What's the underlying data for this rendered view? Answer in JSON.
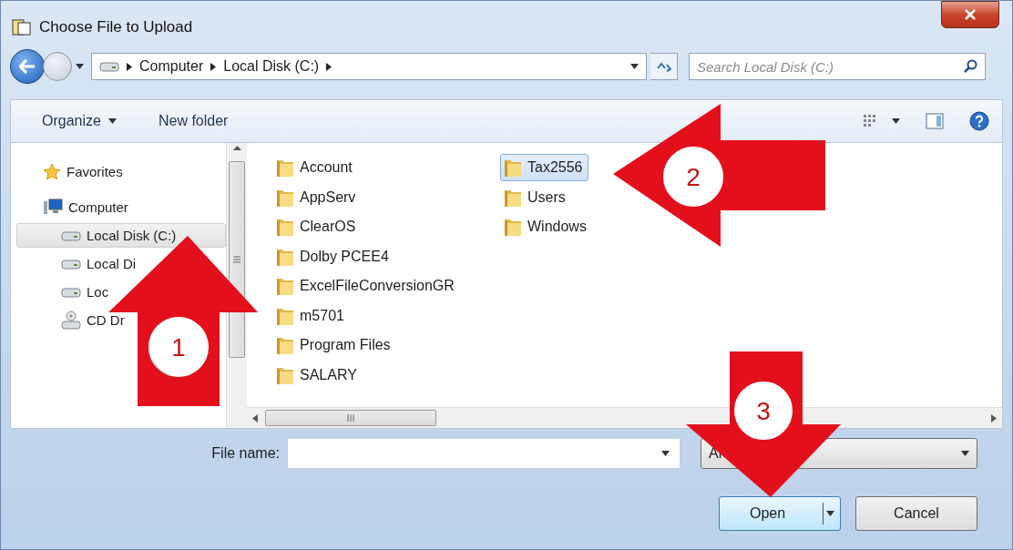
{
  "window": {
    "title": "Choose File to Upload"
  },
  "address_bar": {
    "breadcrumbs": [
      "Computer",
      "Local Disk (C:)"
    ]
  },
  "search": {
    "placeholder": "Search Local Disk (C:)"
  },
  "toolbar": {
    "organize": "Organize",
    "new_folder": "New folder"
  },
  "sidebar": {
    "items": [
      {
        "label": "Favorites",
        "kind": "favorites",
        "selected": false
      },
      {
        "label": "Computer",
        "kind": "computer",
        "selected": false,
        "children": [
          {
            "label": "Local Disk (C:)",
            "kind": "drive",
            "selected": true
          },
          {
            "label": "Local Di",
            "kind": "drive",
            "selected": false
          },
          {
            "label": "Loc",
            "kind": "drive",
            "selected": false
          },
          {
            "label": "CD Dr",
            "kind": "cd",
            "selected": false
          }
        ]
      }
    ]
  },
  "folders": [
    {
      "name": "Account",
      "selected": false
    },
    {
      "name": "AppServ",
      "selected": false
    },
    {
      "name": "ClearOS",
      "selected": false
    },
    {
      "name": "Dolby PCEE4",
      "selected": false
    },
    {
      "name": "ExcelFileConversionGR",
      "selected": false
    },
    {
      "name": "m5701",
      "selected": false
    },
    {
      "name": "Program Files",
      "selected": false
    },
    {
      "name": "SALARY",
      "selected": false
    },
    {
      "name": "Tax2556",
      "selected": true
    },
    {
      "name": "Users",
      "selected": false
    },
    {
      "name": "Windows",
      "selected": false
    }
  ],
  "file_name": {
    "label": "File name:"
  },
  "file_type": {
    "value": "Al"
  },
  "buttons": [
    "Open",
    "Cancel"
  ],
  "annotations": [
    {
      "number": "1",
      "kind": "up"
    },
    {
      "number": "2",
      "kind": "left"
    },
    {
      "number": "3",
      "kind": "down"
    }
  ]
}
